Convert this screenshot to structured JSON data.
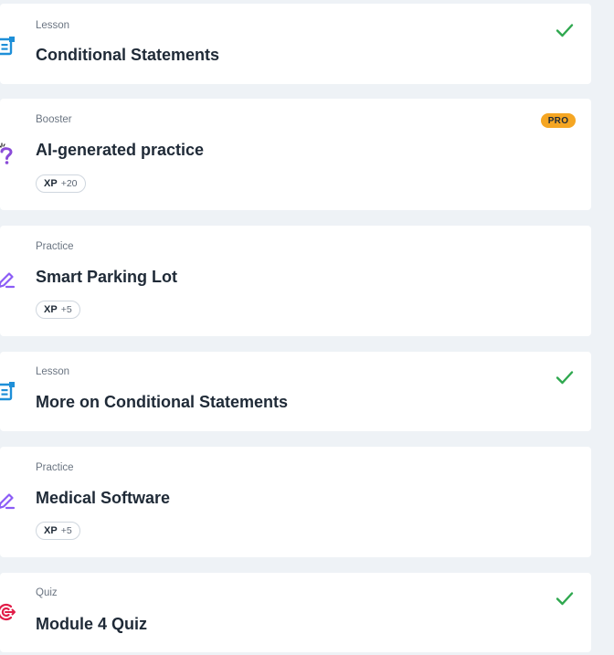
{
  "colors": {
    "background": "#eef2f6",
    "card": "#ffffff",
    "lesson_icon": "#1e8fd8",
    "booster_icon": "#8a4bd8",
    "practice_icon": "#8b5cf6",
    "quiz_icon": "#e11d48",
    "check": "#2fa84f",
    "pro_badge": "#f5a623"
  },
  "items": [
    {
      "type": "Lesson",
      "title": "Conditional Statements",
      "icon": "lesson-icon",
      "completed": true
    },
    {
      "type": "Booster",
      "title": "AI-generated practice",
      "icon": "booster-question-icon",
      "badge": "PRO",
      "xp_label": "XP",
      "xp_value": "+20"
    },
    {
      "type": "Practice",
      "title": "Smart Parking Lot",
      "icon": "practice-pencil-icon",
      "xp_label": "XP",
      "xp_value": "+5"
    },
    {
      "type": "Lesson",
      "title": "More on Conditional Statements",
      "icon": "lesson-icon",
      "completed": true
    },
    {
      "type": "Practice",
      "title": "Medical Software",
      "icon": "practice-pencil-icon",
      "xp_label": "XP",
      "xp_value": "+5"
    },
    {
      "type": "Quiz",
      "title": "Module 4 Quiz",
      "icon": "quiz-target-icon",
      "completed": true
    }
  ]
}
